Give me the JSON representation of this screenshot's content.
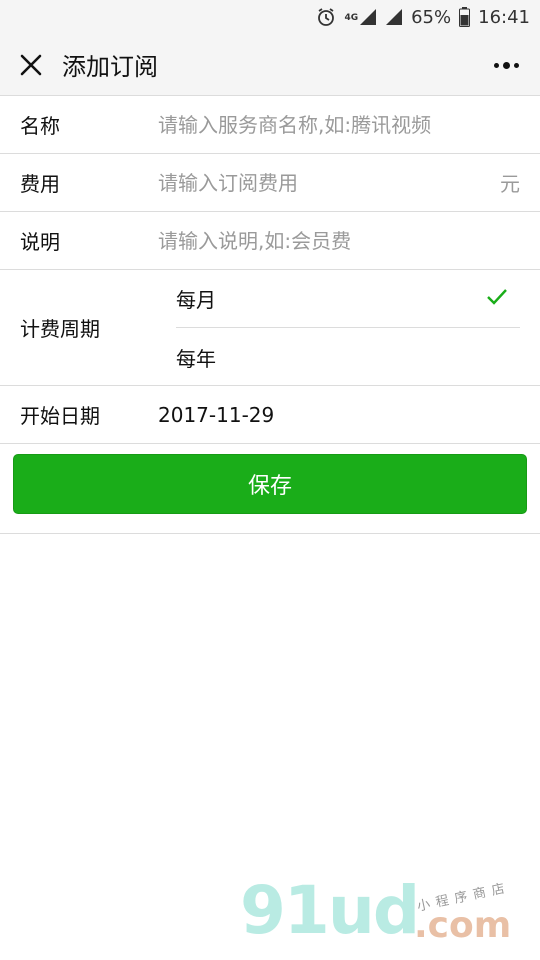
{
  "status_bar": {
    "network": "4G",
    "battery": "65%",
    "time": "16:41",
    "icons": [
      "alarm-icon",
      "signal-icon",
      "signal-icon",
      "battery-icon"
    ]
  },
  "nav": {
    "title": "添加订阅",
    "close_icon": "close-icon",
    "more_icon": "more-icon"
  },
  "form": {
    "name": {
      "label": "名称",
      "placeholder": "请输入服务商名称,如:腾讯视频"
    },
    "cost": {
      "label": "费用",
      "placeholder": "请输入订阅费用",
      "unit": "元"
    },
    "desc": {
      "label": "说明",
      "placeholder": "请输入说明,如:会员费"
    },
    "cycle": {
      "label": "计费周期",
      "options": [
        {
          "label": "每月",
          "selected": true
        },
        {
          "label": "每年",
          "selected": false
        }
      ]
    },
    "start_date": {
      "label": "开始日期",
      "value": "2017-11-29"
    }
  },
  "save_button": {
    "label": "保存",
    "color": "#1aad19"
  },
  "watermark": {
    "brand": "91ud",
    "suffix": ".com",
    "tagline": "小程序商店"
  },
  "colors": {
    "accent": "#1aad19",
    "placeholder": "#9a9a9a",
    "divider": "#dcdcdc"
  }
}
